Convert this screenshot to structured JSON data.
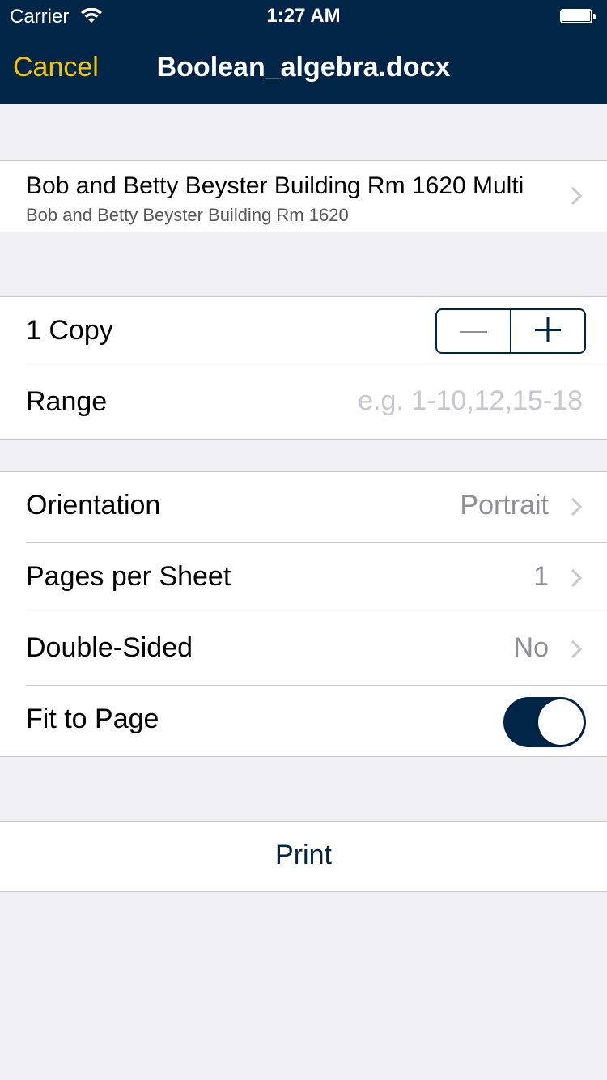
{
  "status_bar": {
    "carrier": "Carrier",
    "time": "1:27 AM"
  },
  "nav": {
    "cancel_label": "Cancel",
    "title": "Boolean_algebra.docx"
  },
  "printer": {
    "name": "Bob and Betty Beyster Building Rm 1620 Multi",
    "location": "Bob and Betty Beyster Building Rm 1620"
  },
  "copies": {
    "label": "1 Copy"
  },
  "range": {
    "label": "Range",
    "placeholder": "e.g. 1-10,12,15-18",
    "value": ""
  },
  "options": {
    "orientation": {
      "label": "Orientation",
      "value": "Portrait"
    },
    "pages_per_sheet": {
      "label": "Pages per Sheet",
      "value": "1"
    },
    "double_sided": {
      "label": "Double-Sided",
      "value": "No"
    },
    "fit_to_page": {
      "label": "Fit to Page",
      "enabled": true
    }
  },
  "print_label": "Print",
  "colors": {
    "bar_background": "#002547",
    "accent_yellow": "#f7c500",
    "group_background": "#efeff4"
  }
}
